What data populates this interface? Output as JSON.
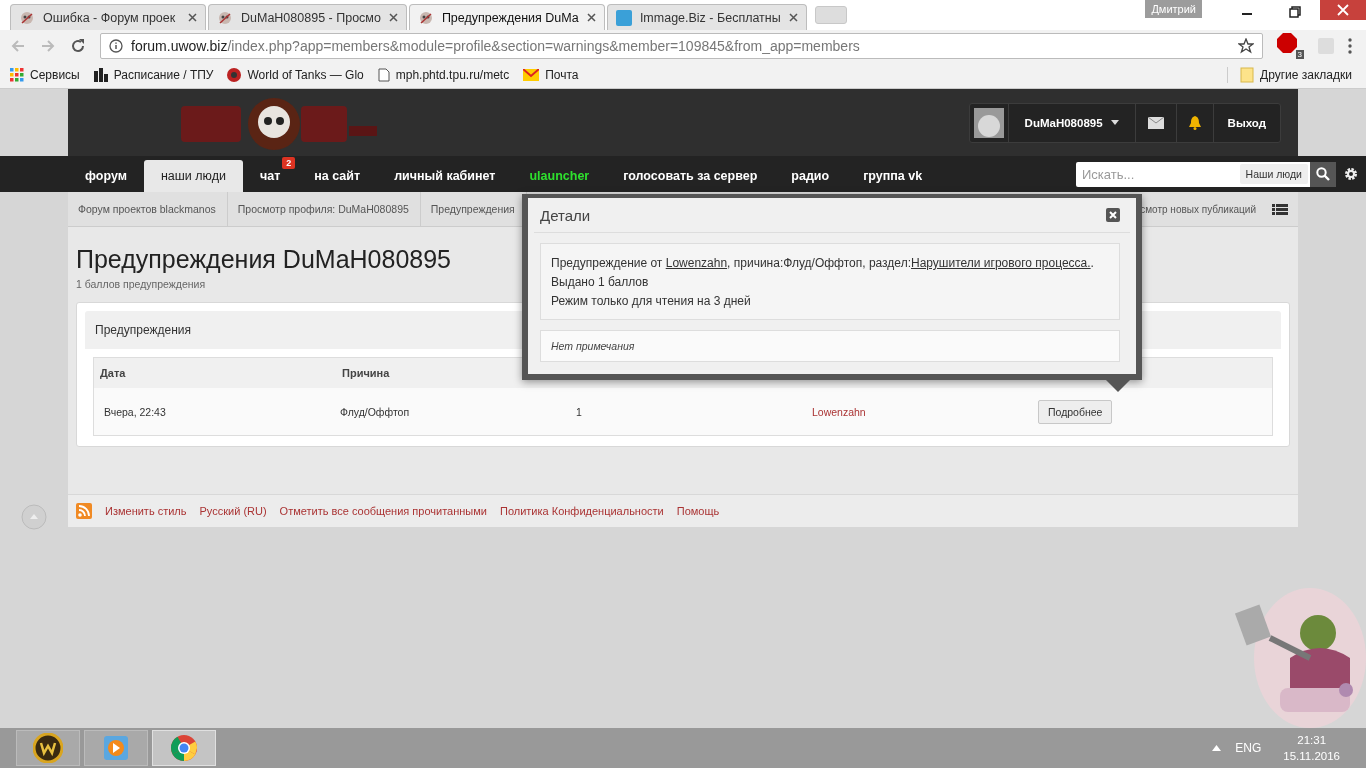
{
  "browser": {
    "tabs": [
      {
        "title": "Ошибка - Форум проек",
        "selected": false,
        "kind": "site"
      },
      {
        "title": "DuMaH080895 - Просмо",
        "selected": false,
        "kind": "site"
      },
      {
        "title": "Предупреждения DuMa",
        "selected": true,
        "kind": "site"
      },
      {
        "title": "Immage.Biz - Бесплатны",
        "selected": false,
        "kind": "ch"
      }
    ],
    "profile": "Дмитрий",
    "url": {
      "host": "forum.uwow.biz",
      "path": "/index.php?app=members&module=profile&section=warnings&member=109845&from_app=members"
    },
    "extension_badge": "3",
    "bookmarks": [
      {
        "label": "Сервисы",
        "kind": "apps"
      },
      {
        "label": "Расписание / ТПУ",
        "kind": "chart"
      },
      {
        "label": "World of Tanks — Glo",
        "kind": "tanks"
      },
      {
        "label": "mph.phtd.tpu.ru/metc",
        "kind": "page"
      },
      {
        "label": "Почта",
        "kind": "mail"
      }
    ],
    "other_bookmarks": "Другие закладки"
  },
  "site": {
    "user": "DuMaH080895",
    "logout": "Выход",
    "nav": [
      {
        "label": "форум",
        "selected": false,
        "kind": "normal"
      },
      {
        "label": "наши люди",
        "selected": true,
        "kind": "normal"
      },
      {
        "label": "чат",
        "selected": false,
        "kind": "normal",
        "badge": "2"
      },
      {
        "label": "на сайт",
        "selected": false,
        "kind": "normal"
      },
      {
        "label": "личный кабинет",
        "selected": false,
        "kind": "normal"
      },
      {
        "label": "ulauncher",
        "selected": false,
        "kind": "accent"
      },
      {
        "label": "голосовать за сервер",
        "selected": false,
        "kind": "normal"
      },
      {
        "label": "радио",
        "selected": false,
        "kind": "normal"
      },
      {
        "label": "группа vk",
        "selected": false,
        "kind": "normal"
      }
    ],
    "search": {
      "placeholder": "Искать...",
      "scope": "Наши люди"
    },
    "breadcrumbs": [
      "Форум проектов blackmanos",
      "Просмотр профиля: DuMaH080895",
      "Предупреждения"
    ],
    "breadcrumb_right": "смотр новых публикаций",
    "title": "Предупреждения DuMaH080895",
    "subtitle": "1 баллов предупреждения",
    "panel": {
      "title": "Предупреждения",
      "columns": [
        "Дата",
        "Причина"
      ],
      "rows": [
        {
          "cells": [
            "Вчера, 22:43",
            "Флуд/Оффтоп",
            "1",
            "Lowenzahn"
          ],
          "button": "Подробнее"
        }
      ]
    },
    "modal": {
      "title": "Детали",
      "message": [
        {
          "text": "Предупреждение от ",
          "link": false
        },
        {
          "text": "Lowenzahn",
          "link": true
        },
        {
          "text": ", причина:Флуд/Оффтоп, раздел:",
          "link": false
        },
        {
          "text": "Нарушители игрового процесса.",
          "link": true
        },
        {
          "text": ".",
          "link": false
        }
      ],
      "lines": [
        "Выдано 1 баллов",
        "Режим только для чтения на 3 дней"
      ],
      "note": "Нет примечания"
    },
    "footer": [
      "Изменить стиль",
      "Русский (RU)",
      "Отметить все сообщения прочитанными",
      "Политика Конфиденциальности",
      "Помощь"
    ]
  },
  "taskbar": {
    "apps": [
      {
        "kind": "wow",
        "selected": false
      },
      {
        "kind": "player",
        "selected": false
      },
      {
        "kind": "chrome",
        "selected": true
      }
    ],
    "language": "ENG",
    "time": "21:31",
    "date": "15.11.2016"
  }
}
